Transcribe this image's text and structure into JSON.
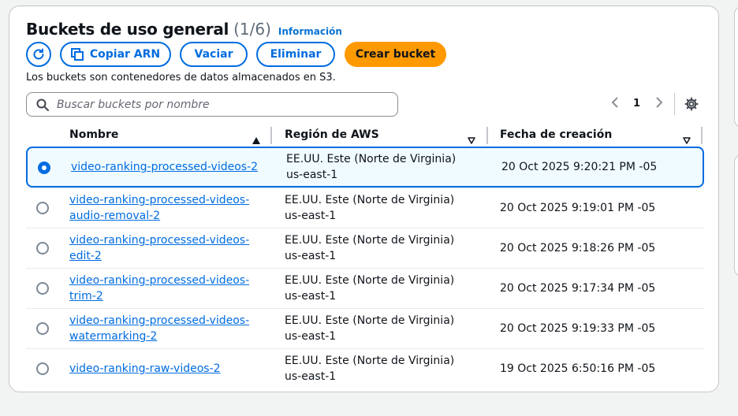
{
  "panel": {
    "title": "Buckets de uso general",
    "count": "(1/6)",
    "info_link": "Información",
    "description": "Los buckets son contenedores de datos almacenados en S3."
  },
  "toolbar": {
    "refresh_icon": "refresh-icon",
    "copy_arn_label": "Copiar ARN",
    "empty_label": "Vaciar",
    "delete_label": "Eliminar",
    "create_label": "Crear bucket"
  },
  "search": {
    "placeholder": "Buscar buckets por nombre"
  },
  "pagination": {
    "prev": "<",
    "page": "1",
    "next": ">"
  },
  "table": {
    "columns": [
      "Nombre",
      "Región de AWS",
      "Fecha de creación"
    ],
    "rows": [
      {
        "selected": true,
        "name": "video-ranking-processed-videos-2",
        "region": "EE.UU. Este (Norte de Virginia) us-east-1",
        "created": "20 Oct 2025 9:20:21 PM -05"
      },
      {
        "selected": false,
        "name": "video-ranking-processed-videos-audio-removal-2",
        "region": "EE.UU. Este (Norte de Virginia) us-east-1",
        "created": "20 Oct 2025 9:19:01 PM -05"
      },
      {
        "selected": false,
        "name": "video-ranking-processed-videos-edit-2",
        "region": "EE.UU. Este (Norte de Virginia) us-east-1",
        "created": "20 Oct 2025 9:18:26 PM -05"
      },
      {
        "selected": false,
        "name": "video-ranking-processed-videos-trim-2",
        "region": "EE.UU. Este (Norte de Virginia) us-east-1",
        "created": "20 Oct 2025 9:17:34 PM -05"
      },
      {
        "selected": false,
        "name": "video-ranking-processed-videos-watermarking-2",
        "region": "EE.UU. Este (Norte de Virginia) us-east-1",
        "created": "20 Oct 2025 9:19:33 PM -05"
      },
      {
        "selected": false,
        "name": "video-ranking-raw-videos-2",
        "region": "EE.UU. Este (Norte de Virginia) us-east-1",
        "created": "19 Oct 2025 6:50:16 PM -05"
      }
    ]
  },
  "colors": {
    "accent": "#006ce0",
    "primary_button": "#ff9900",
    "selected_row_bg": "#f0fbff"
  }
}
